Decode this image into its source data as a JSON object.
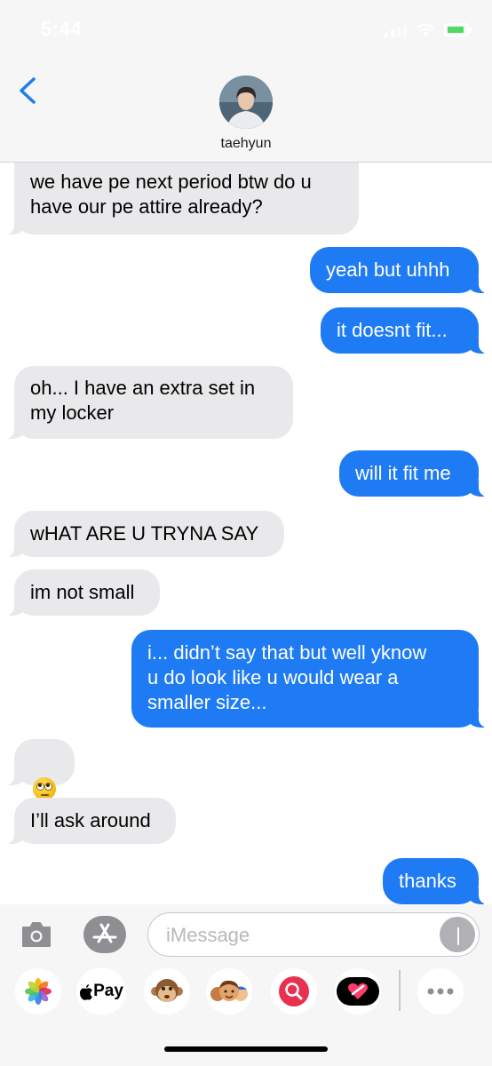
{
  "status_bar": {
    "time": "5:44"
  },
  "header": {
    "contact_name": "taehyun"
  },
  "messages": [
    {
      "text": "we have pe next period btw do u\nhave our pe attire already?"
    },
    {
      "text": "yeah but uhhh"
    },
    {
      "text": "it doesnt fit..."
    },
    {
      "text": "oh... I have an extra set in\nmy locker"
    },
    {
      "text": "will it fit me"
    },
    {
      "text": "wHAT ARE U TRYNA SAY"
    },
    {
      "text": "im not small"
    },
    {
      "text": "i... didn’t say that but well yknow\nu do look like u would wear a\nsmaller size..."
    },
    {
      "text": "I’ll ask around"
    },
    {
      "text": "thanks"
    }
  ],
  "composer": {
    "placeholder": "iMessage"
  },
  "drawer": {
    "apple_pay_label": "Pay"
  },
  "colors": {
    "outgoing": "#1f7bf3",
    "incoming": "#e9e9eb",
    "header": "#f6f6f6"
  },
  "icons": [
    "back-chevron-icon",
    "camera-icon",
    "app-store-icon",
    "audio-waveform-icon",
    "photos-icon",
    "apple-pay-icon",
    "monkey-memoji-icon",
    "memoji-group-icon",
    "search-images-icon",
    "digital-touch-icon",
    "more-icon",
    "eye-roll-emoji"
  ]
}
